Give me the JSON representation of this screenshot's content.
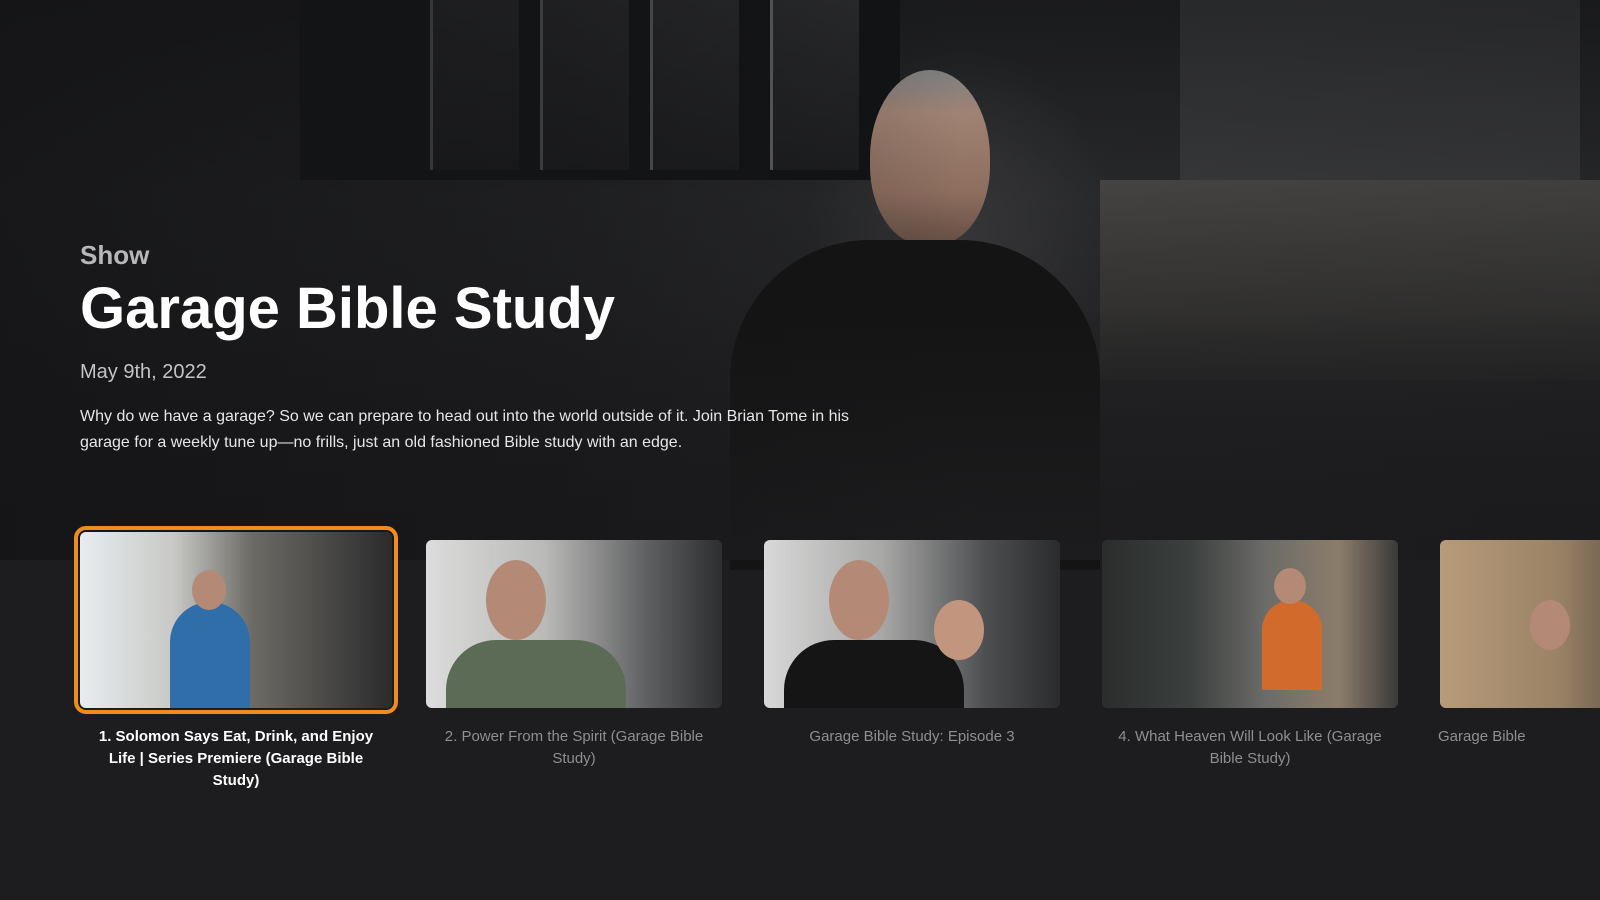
{
  "hero": {
    "eyebrow": "Show",
    "title": "Garage Bible Study",
    "date": "May 9th, 2022",
    "description": "Why do we have a garage? So we can prepare to head out into the world outside of it. Join Brian Tome in his garage for a weekly tune up—no frills, just an old fashioned Bible study with an edge."
  },
  "episodes": [
    {
      "label": "1. Solomon Says Eat, Drink, and Enjoy Life | Series Premiere (Garage Bible Study)",
      "focused": true
    },
    {
      "label": "2. Power From the Spirit (Garage Bible Study)",
      "focused": false
    },
    {
      "label": "Garage Bible Study: Episode 3",
      "focused": false
    },
    {
      "label": "4. What Heaven Will Look Like (Garage Bible Study)",
      "focused": false
    },
    {
      "label": "Garage Bible",
      "focused": false
    }
  ],
  "colors": {
    "focus_ring": "#f08c1e",
    "background": "#1d1d1f"
  }
}
